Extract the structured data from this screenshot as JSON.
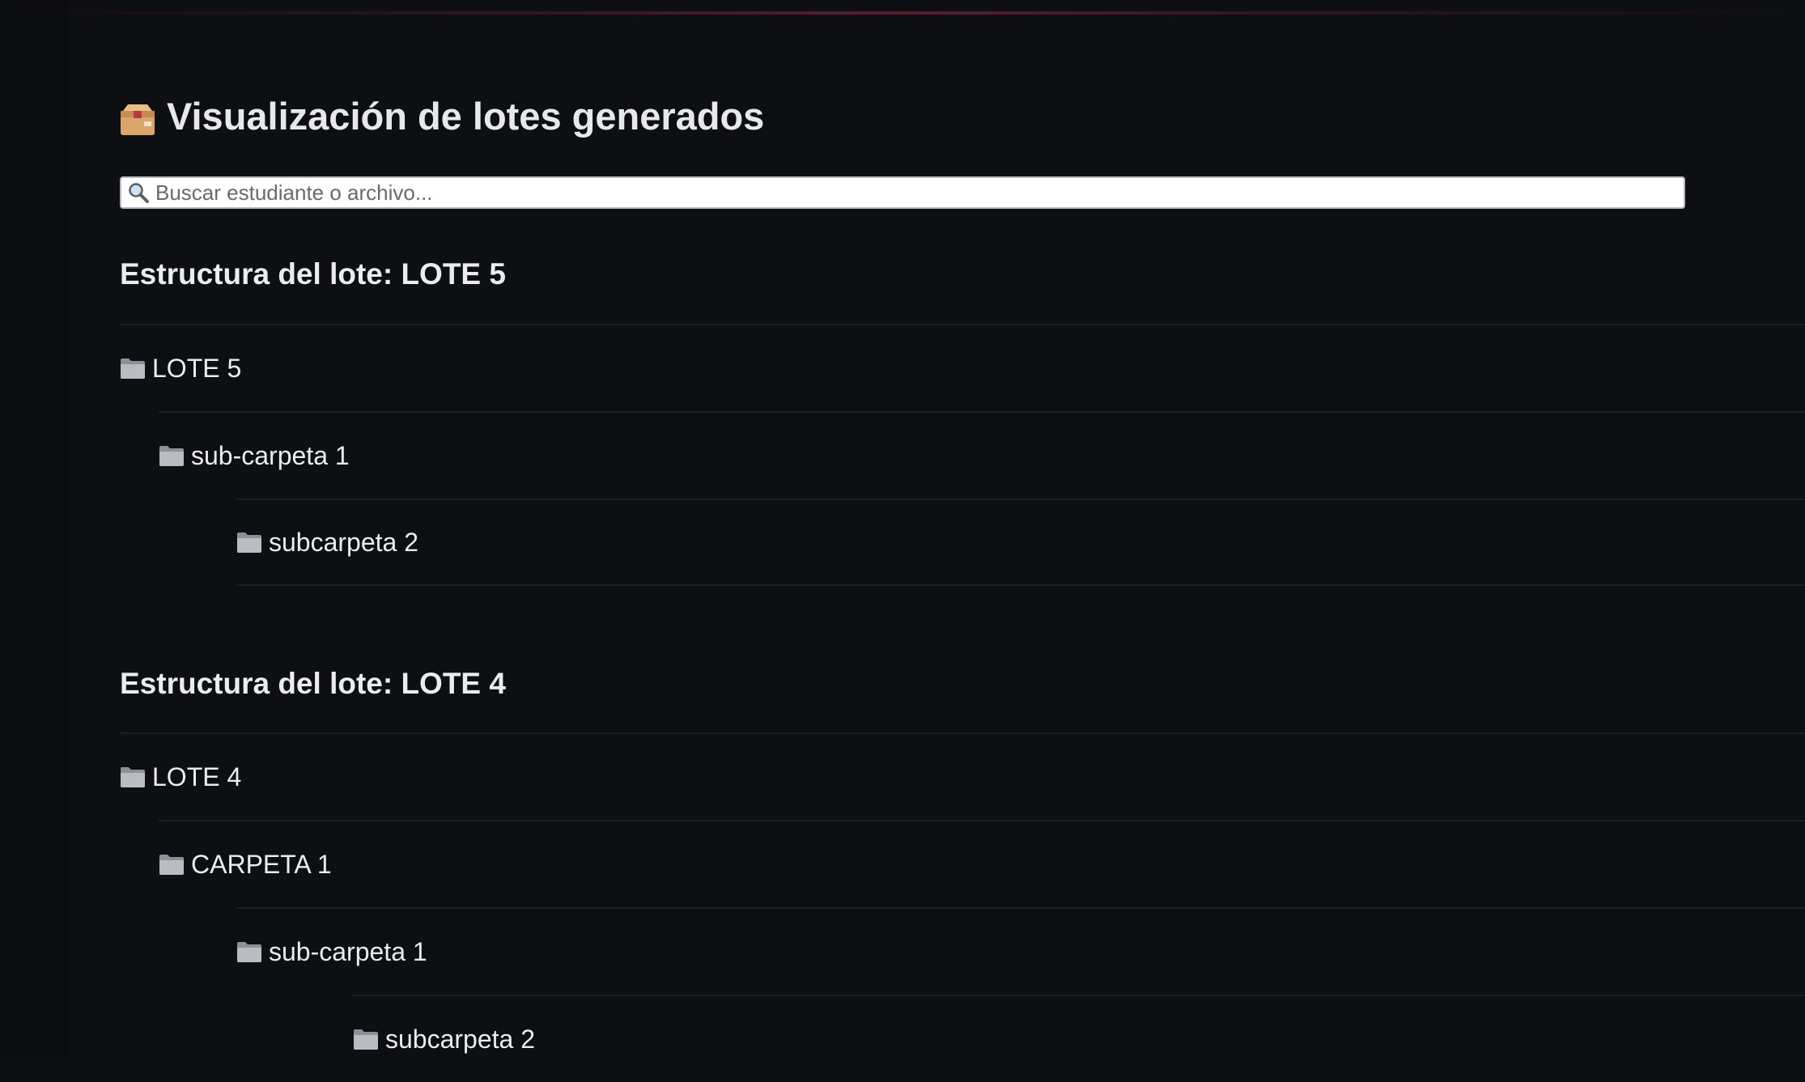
{
  "page": {
    "title": "Visualización de lotes generados",
    "title_icon": "package-box-icon"
  },
  "search": {
    "placeholder": "Buscar estudiante o archivo...",
    "value": "",
    "icon": "search-icon"
  },
  "lots": [
    {
      "heading": "Estructura del lote: LOTE 5",
      "rows": [
        {
          "label": "LOTE 5",
          "icon": "folder-icon",
          "level": 0
        },
        {
          "label": "sub-carpeta 1",
          "icon": "folder-icon",
          "level": 1
        },
        {
          "label": "subcarpeta 2",
          "icon": "folder-icon",
          "level": 2
        }
      ]
    },
    {
      "heading": "Estructura del lote: LOTE 4",
      "rows": [
        {
          "label": "LOTE 4",
          "icon": "folder-icon",
          "level": 0
        },
        {
          "label": "CARPETA 1",
          "icon": "folder-icon",
          "level": 1
        },
        {
          "label": "sub-carpeta 1",
          "icon": "folder-icon",
          "level": 2
        },
        {
          "label": "subcarpeta 2",
          "icon": "folder-icon",
          "level": 3
        }
      ]
    }
  ],
  "colors": {
    "background": "#0e0f13",
    "text": "#ececee",
    "divider": "#1d1f25",
    "accent_line": "#a0284a"
  }
}
